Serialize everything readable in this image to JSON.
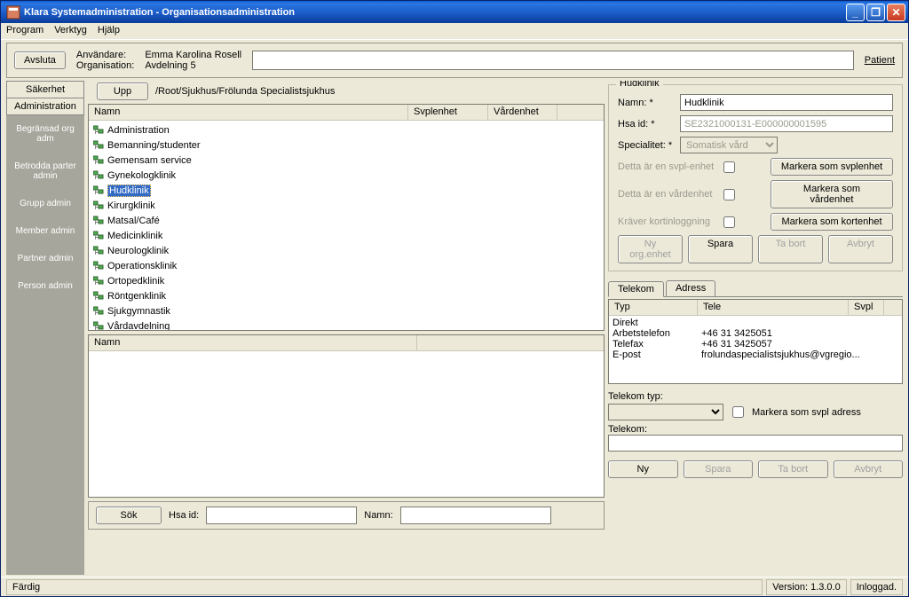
{
  "title": "Klara Systemadministration - Organisationsadministration",
  "menu": {
    "program": "Program",
    "verktyg": "Verktyg",
    "hjalp": "Hjälp"
  },
  "top": {
    "avsluta": "Avsluta",
    "user_lbl": "Användare:",
    "user_val": "Emma Karolina Rosell",
    "org_lbl": "Organisation:",
    "org_val": "Avdelning 5",
    "patient": "Patient"
  },
  "side": {
    "tab1": "Säkerhet",
    "tab2": "Administration",
    "items": [
      "Begränsad org adm",
      "Betrodda parter admin",
      "Grupp admin",
      "Member admin",
      "Partner admin",
      "Person admin"
    ]
  },
  "path": {
    "upp": "Upp",
    "crumb": "/Root/Sjukhus/Frölunda Specialistsjukhus"
  },
  "cols": {
    "namn": "Namn",
    "svpl": "Svplenhet",
    "vard": "Vårdenhet"
  },
  "list1": [
    "Administration",
    "Bemanning/studenter",
    "Gemensam service",
    "Gynekologklinik",
    "Hudklinik",
    "Kirurgklinik",
    "Matsal/Café",
    "Medicinklinik",
    "Neurologklinik",
    "Operationsklinik",
    "Ortopedklinik",
    "Röntgenklinik",
    "Sjukgymnastik",
    "Vårdavdelning"
  ],
  "selectedIndex": 4,
  "search": {
    "sok": "Sök",
    "hsaid": "Hsa id:",
    "namn": "Namn:"
  },
  "detail": {
    "title": "Hudklinik",
    "namn_lbl": "Namn: *",
    "namn_val": "Hudklinik",
    "hsa_lbl": "Hsa id: *",
    "hsa_val": "SE2321000131-E000000001595",
    "spec_lbl": "Specialitet: *",
    "spec_val": "Somatisk vård",
    "chk1": "Detta är en svpl-enhet",
    "chk2": "Detta är en vårdenhet",
    "chk3": "Kräver kortinloggning",
    "btn_mark1": "Markera som svplenhet",
    "btn_mark2": "Markera som vårdenhet",
    "btn_mark3": "Markera som kortenhet",
    "btn_ny": "Ny org.enhet",
    "btn_spara": "Spara",
    "btn_tabort": "Ta bort",
    "btn_avbryt": "Avbryt"
  },
  "tabs": {
    "telekom": "Telekom",
    "adress": "Adress"
  },
  "tele": {
    "col_typ": "Typ",
    "col_tele": "Tele",
    "col_svpl": "Svpl",
    "rows": [
      {
        "typ": "Direkt",
        "tele": ""
      },
      {
        "typ": "Arbetstelefon",
        "tele": "+46 31 3425051"
      },
      {
        "typ": "Telefax",
        "tele": "+46 31 3425057"
      },
      {
        "typ": "E-post",
        "tele": "frolundaspecialistsjukhus@vgregio..."
      }
    ],
    "typ_lbl": "Telekom typ:",
    "mark_svpl": "Markera som svpl adress",
    "telekom_lbl": "Telekom:",
    "btn_ny": "Ny",
    "btn_spara": "Spara",
    "btn_tabort": "Ta bort",
    "btn_avbryt": "Avbryt"
  },
  "status": {
    "fardig": "Färdig",
    "version": "Version: 1.3.0.0",
    "inloggad": "Inloggad."
  }
}
